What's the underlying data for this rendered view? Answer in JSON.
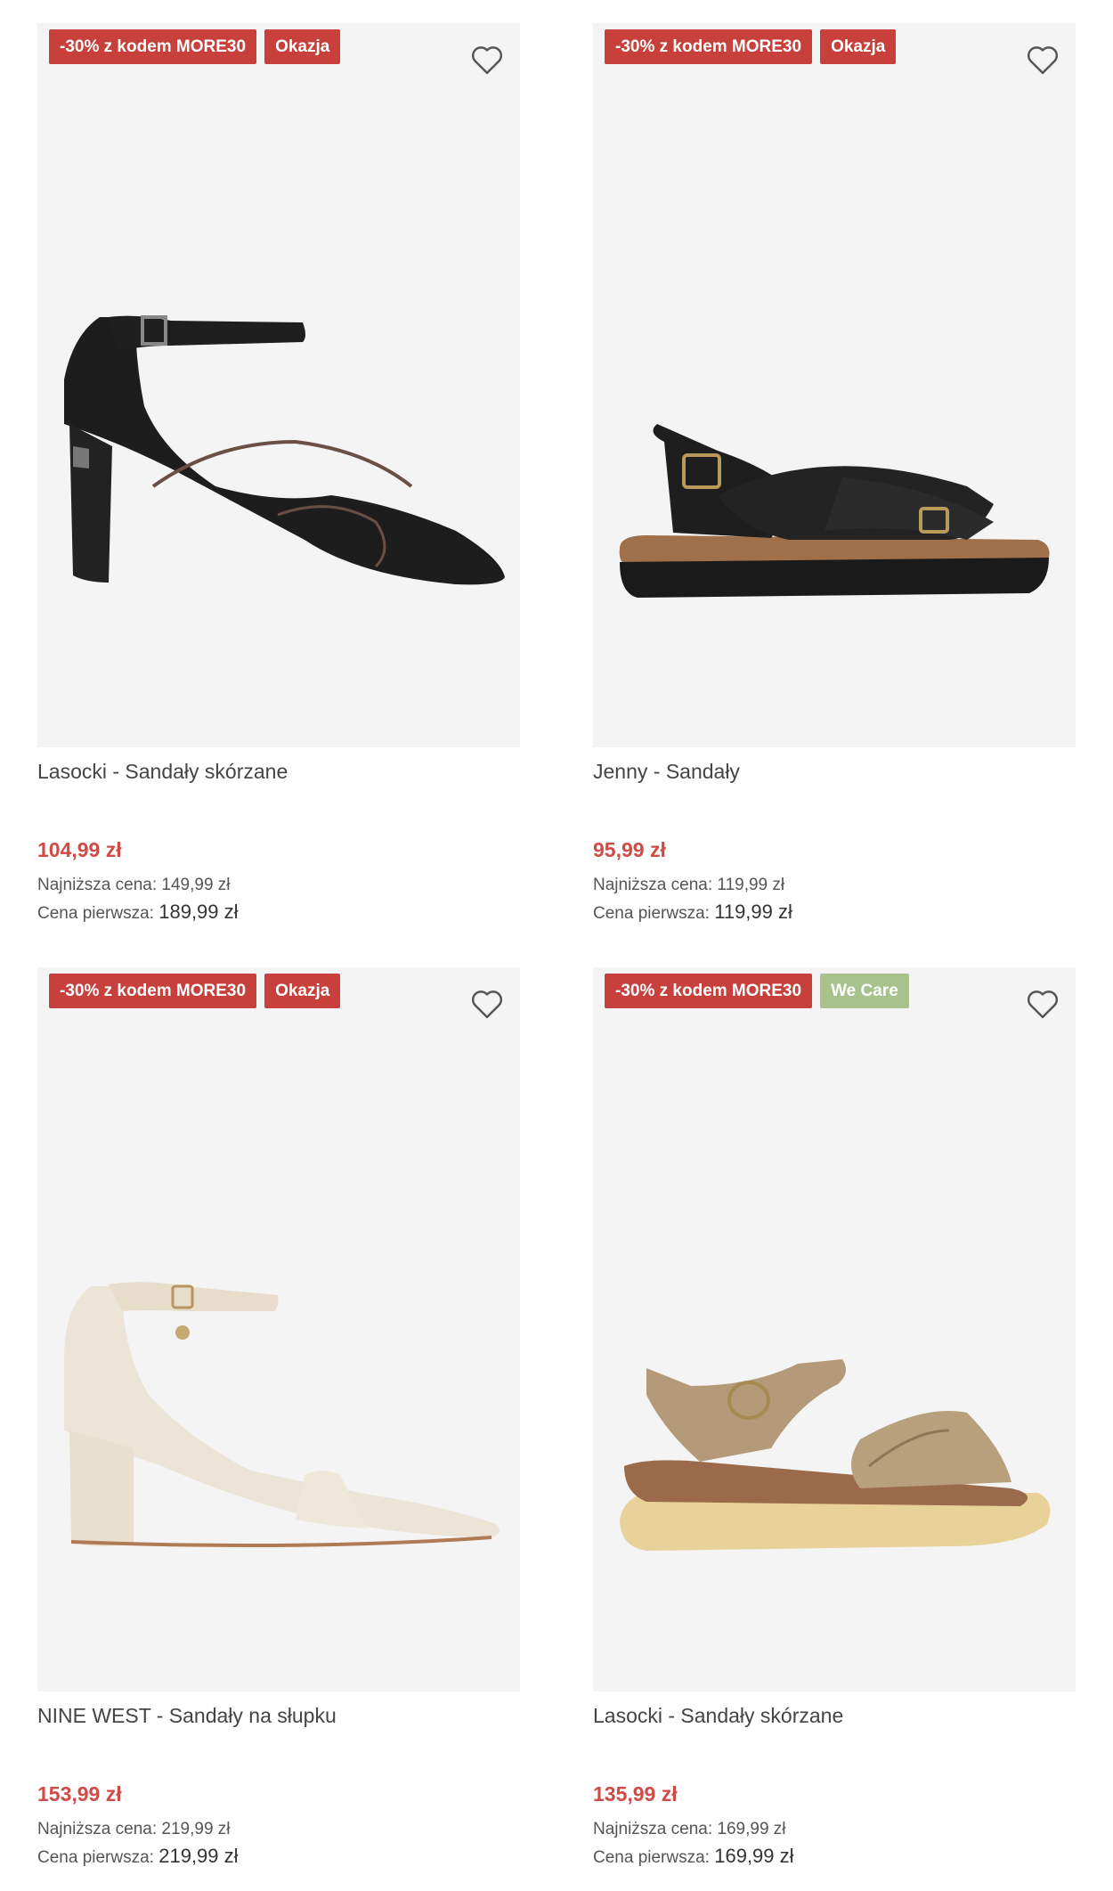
{
  "colors": {
    "promo_badge": "#c8403b",
    "okazja_badge": "#c8403b",
    "we_care_badge": "#a7c28c",
    "price": "#d04b45",
    "card_bg": "#f4f4f4"
  },
  "products": [
    {
      "badges": [
        {
          "label": "-30% z kodem MORE30",
          "type": "promo"
        },
        {
          "label": "Okazja",
          "type": "okazja"
        }
      ],
      "image": "black-heeled-sandal",
      "title": "Lasocki - Sandały skórzane",
      "price": "104,99 zł",
      "lowest_label": "Najniższa cena:",
      "lowest_value": "149,99 zł",
      "first_label": "Cena pierwsza:",
      "first_value": "189,99 zł"
    },
    {
      "badges": [
        {
          "label": "-30% z kodem MORE30",
          "type": "promo"
        },
        {
          "label": "Okazja",
          "type": "okazja"
        }
      ],
      "image": "black-cork-sandal",
      "title": "Jenny - Sandały",
      "price": "95,99 zł",
      "lowest_label": "Najniższa cena:",
      "lowest_value": "119,99 zł",
      "first_label": "Cena pierwsza:",
      "first_value": "119,99 zł"
    },
    {
      "badges": [
        {
          "label": "-30% z kodem MORE30",
          "type": "promo"
        },
        {
          "label": "Okazja",
          "type": "okazja"
        }
      ],
      "image": "cream-block-heel-sandal",
      "title": "NINE WEST - Sandały na słupku",
      "price": "153,99 zł",
      "lowest_label": "Najniższa cena:",
      "lowest_value": "219,99 zł",
      "first_label": "Cena pierwsza:",
      "first_value": "219,99 zł"
    },
    {
      "badges": [
        {
          "label": "-30% z kodem MORE30",
          "type": "promo"
        },
        {
          "label": "We Care",
          "type": "wecare"
        }
      ],
      "image": "beige-wedge-sandal",
      "title": "Lasocki - Sandały skórzane",
      "price": "135,99 zł",
      "lowest_label": "Najniższa cena:",
      "lowest_value": "169,99 zł",
      "first_label": "Cena pierwsza:",
      "first_value": "169,99 zł"
    }
  ]
}
